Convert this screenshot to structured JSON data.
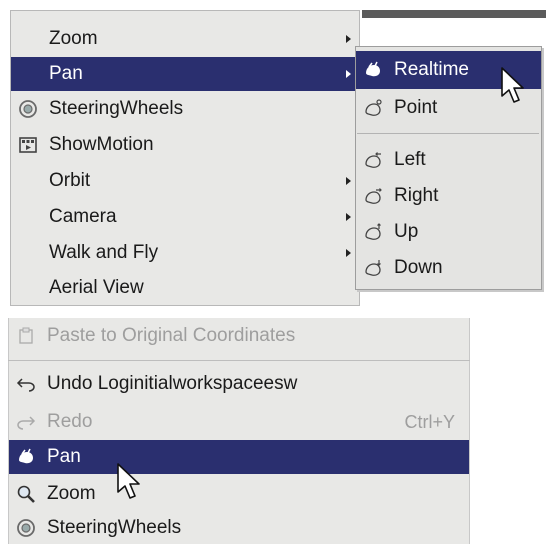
{
  "main_menu": {
    "items": [
      {
        "label": "Zoom",
        "has_submenu": true
      },
      {
        "label": "Pan",
        "has_submenu": true
      },
      {
        "label": "SteeringWheels",
        "has_submenu": false
      },
      {
        "label": "ShowMotion",
        "has_submenu": false
      },
      {
        "label": "Orbit",
        "has_submenu": true
      },
      {
        "label": "Camera",
        "has_submenu": true
      },
      {
        "label": "Walk and Fly",
        "has_submenu": true
      },
      {
        "label": "Aerial View",
        "has_submenu": false
      }
    ],
    "highlighted": "Pan"
  },
  "pan_submenu": {
    "items": [
      {
        "label": "Realtime"
      },
      {
        "label": "Point"
      },
      {
        "label": "Left"
      },
      {
        "label": "Right"
      },
      {
        "label": "Up"
      },
      {
        "label": "Down"
      }
    ],
    "highlighted": "Realtime"
  },
  "context_menu": {
    "items": [
      {
        "label": "Paste to Original Coordinates",
        "disabled": true
      },
      {
        "label": "Undo Loginitialworkspaceesw",
        "disabled": false
      },
      {
        "label": "Redo",
        "shortcut": "Ctrl+Y",
        "disabled": true
      },
      {
        "label": "Pan",
        "disabled": false
      },
      {
        "label": "Zoom",
        "disabled": false
      },
      {
        "label": "SteeringWheels",
        "disabled": false
      }
    ],
    "highlighted": "Pan"
  },
  "colors": {
    "highlight": "#2a2f6f",
    "menu_bg": "#e8e8e6",
    "disabled_text": "#9e9e9e"
  }
}
